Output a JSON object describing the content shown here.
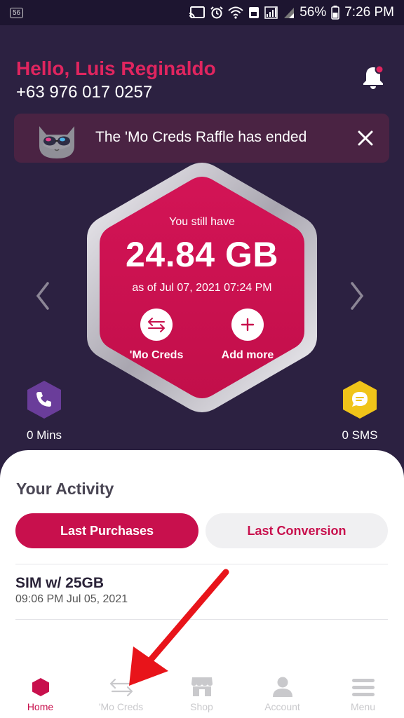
{
  "status_bar": {
    "sim": "56",
    "battery": "56%",
    "time": "7:26 PM"
  },
  "header": {
    "greeting": "Hello, Luis Reginaldo",
    "phone": "+63 976 017 0257"
  },
  "raffle": {
    "text": "The 'Mo Creds Raffle has ended"
  },
  "balance": {
    "prefix": "You still have",
    "amount": "24.84 GB",
    "as_of": "as of Jul 07, 2021 07:24 PM",
    "creds_label": "'Mo Creds",
    "add_label": "Add more"
  },
  "minutes": {
    "label": "0 Mins"
  },
  "sms": {
    "label": "0 SMS"
  },
  "activity": {
    "title": "Your Activity",
    "tabs": [
      "Last Purchases",
      "Last Conversion"
    ],
    "items": [
      {
        "title": "SIM w/ 25GB",
        "date": "09:06 PM Jul 05, 2021"
      }
    ]
  },
  "bottom_nav": [
    {
      "label": "Home",
      "icon": "hexagon-icon"
    },
    {
      "label": "'Mo Creds",
      "icon": "swap-arrows-icon"
    },
    {
      "label": "Shop",
      "icon": "shop-icon"
    },
    {
      "label": "Account",
      "icon": "person-icon"
    },
    {
      "label": "Menu",
      "icon": "menu-icon"
    }
  ],
  "colors": {
    "brand": "#c8104d",
    "header_bg": "#2c2141",
    "minutes": "#6a3d9a",
    "sms": "#f0c419",
    "annotation_arrow": "#e8141a"
  }
}
